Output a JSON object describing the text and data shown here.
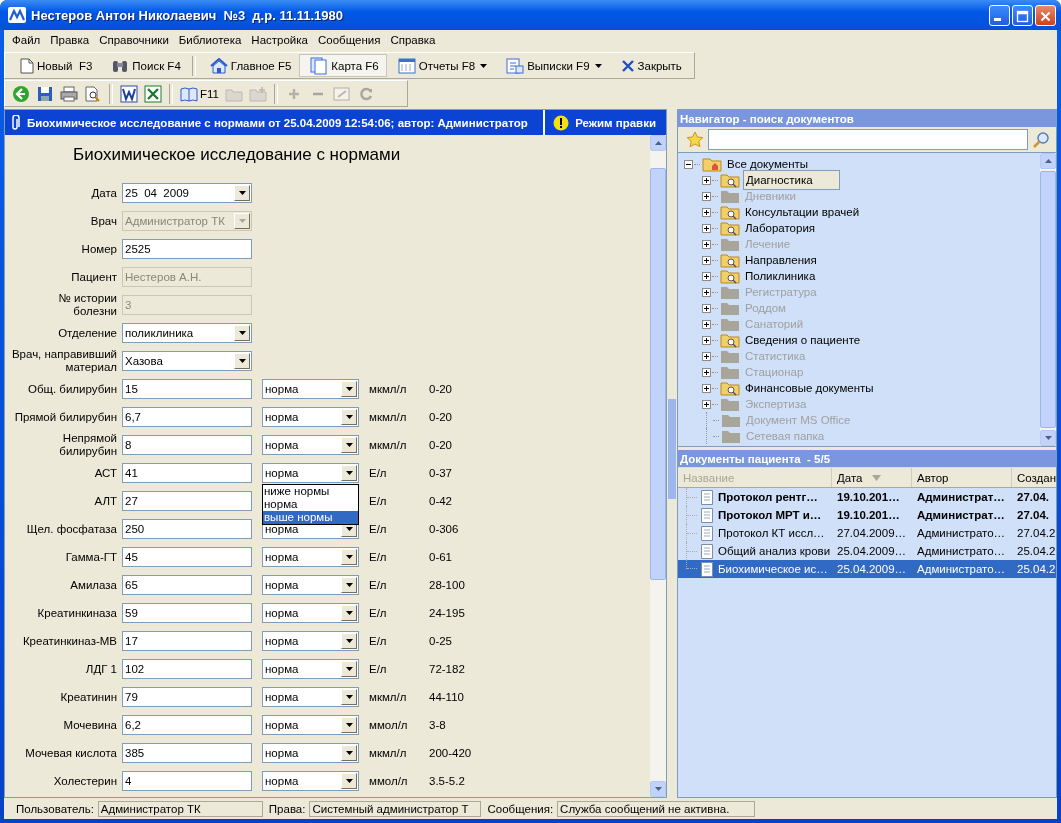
{
  "window": {
    "title": "Нестеров Антон Николаевич  №3  д.р. 11.11.1980"
  },
  "menu": [
    {
      "label": "Файл"
    },
    {
      "label": "Правка"
    },
    {
      "label": "Справочники"
    },
    {
      "label": "Библиотека"
    },
    {
      "label": "Настройка"
    },
    {
      "label": "Сообщения"
    },
    {
      "label": "Справка"
    }
  ],
  "toolbar": [
    {
      "kind": "button",
      "label": "Новый  F3",
      "selected": false,
      "dropdown": false
    },
    {
      "kind": "button",
      "label": "Поиск F4",
      "selected": false,
      "dropdown": false
    },
    {
      "kind": "separator"
    },
    {
      "kind": "button",
      "label": "Главное F5",
      "selected": false,
      "dropdown": false
    },
    {
      "kind": "button",
      "label": "Карта F6",
      "selected": true,
      "dropdown": false
    },
    {
      "kind": "button",
      "label": "Отчеты F8",
      "selected": false,
      "dropdown": true
    },
    {
      "kind": "button",
      "label": "Выписки F9",
      "selected": false,
      "dropdown": true
    },
    {
      "kind": "button",
      "label": "Закрыть",
      "selected": false,
      "dropdown": false
    }
  ],
  "toolbar2": [
    {
      "kind": "button",
      "disabled": false
    },
    {
      "kind": "button",
      "disabled": false
    },
    {
      "kind": "button",
      "disabled": false
    },
    {
      "kind": "button",
      "disabled": false
    },
    {
      "kind": "separator"
    },
    {
      "kind": "button",
      "disabled": false
    },
    {
      "kind": "button",
      "disabled": false
    },
    {
      "kind": "separator"
    },
    {
      "kind": "button",
      "label": "F11",
      "disabled": false
    },
    {
      "kind": "button",
      "disabled": true
    },
    {
      "kind": "button",
      "disabled": true
    },
    {
      "kind": "separator"
    },
    {
      "kind": "button",
      "disabled": true
    },
    {
      "kind": "button",
      "disabled": true
    },
    {
      "kind": "button",
      "disabled": true
    },
    {
      "kind": "button",
      "disabled": true
    }
  ],
  "document_header": {
    "title": "Биохимическое исследование с нормами от 25.04.2009 12:54:06; автор: Администратор",
    "mode": "Режим правки"
  },
  "form": {
    "title": "Биохимическое исследование с нормами",
    "fields": [
      {
        "label": "Дата",
        "value": "25  04  2009",
        "kind": "combo",
        "disabled": false
      },
      {
        "label": "Врач",
        "value": "Администратор ТК",
        "kind": "combo",
        "disabled": true
      },
      {
        "label": "Номер",
        "value": "2525",
        "kind": "text",
        "disabled": false
      },
      {
        "label": "Пациент",
        "value": "Нестеров А.Н.",
        "kind": "text",
        "disabled": true
      },
      {
        "label": "№ истории\nболезни",
        "value": "3",
        "kind": "text",
        "disabled": true
      },
      {
        "label": "Отделение",
        "value": "поликлиника",
        "kind": "combo",
        "disabled": false
      },
      {
        "label": "Врач, направивший\nматериал",
        "value": "Хазова",
        "kind": "combo",
        "disabled": false
      }
    ],
    "tests": [
      {
        "name": "Общ. билирубин",
        "value": "15",
        "status": "норма",
        "unit": "мкмл/л",
        "range": "0-20",
        "open": false
      },
      {
        "name": "Прямой билирубин",
        "value": "6,7",
        "status": "норма",
        "unit": "мкмл/л",
        "range": "0-20",
        "open": false
      },
      {
        "name": "Непрямой\nбилирубин",
        "value": "8",
        "status": "норма",
        "unit": "мкмл/л",
        "range": "0-20",
        "open": false
      },
      {
        "name": "АСТ",
        "value": "41",
        "status": "норма",
        "unit": "Е/л",
        "range": "0-37",
        "open": true,
        "options": [
          {
            "label": "ниже нормы",
            "selected": false
          },
          {
            "label": "норма",
            "selected": false
          },
          {
            "label": "выше нормы",
            "selected": true
          }
        ]
      },
      {
        "name": "АЛТ",
        "value": "27",
        "unit": "Е/л",
        "range": "0-42",
        "open": false
      },
      {
        "name": "Щел. фосфатаза",
        "value": "250",
        "status": "норма",
        "unit": "Е/л",
        "range": "0-306",
        "open": false
      },
      {
        "name": "Гамма-ГТ",
        "value": "45",
        "status": "норма",
        "unit": "Е/л",
        "range": "0-61",
        "open": false
      },
      {
        "name": "Амилаза",
        "value": "65",
        "status": "норма",
        "unit": "Е/л",
        "range": "28-100",
        "open": false
      },
      {
        "name": "Креатинкиназа",
        "value": "59",
        "status": "норма",
        "unit": "Е/л",
        "range": "24-195",
        "open": false
      },
      {
        "name": "Креатинкиназ-МВ",
        "value": "17",
        "status": "норма",
        "unit": "Е/л",
        "range": "0-25",
        "open": false
      },
      {
        "name": "ЛДГ 1",
        "value": "102",
        "status": "норма",
        "unit": "Е/л",
        "range": "72-182",
        "open": false
      },
      {
        "name": "Креатинин",
        "value": "79",
        "status": "норма",
        "unit": "мкмл/л",
        "range": "44-110",
        "open": false
      },
      {
        "name": "Мочевина",
        "value": "6,2",
        "status": "норма",
        "unit": "ммол/л",
        "range": "3-8",
        "open": false
      },
      {
        "name": "Мочевая кислота",
        "value": "385",
        "status": "норма",
        "unit": "мкмл/л",
        "range": "200-420",
        "open": false
      },
      {
        "name": "Холестерин",
        "value": "4",
        "status": "норма",
        "unit": "ммол/л",
        "range": "3.5-5.2",
        "open": false
      }
    ]
  },
  "navigator": {
    "title": "Навигатор - поиск документов",
    "tree": {
      "label": "Все документы",
      "expanded": true,
      "children": [
        {
          "label": "Диагностика",
          "disabled": false,
          "expandable": true,
          "selected": true
        },
        {
          "label": "Дневники",
          "disabled": true,
          "expandable": true,
          "selected": false
        },
        {
          "label": "Консультации врачей",
          "disabled": false,
          "expandable": true,
          "selected": false
        },
        {
          "label": "Лаборатория",
          "disabled": false,
          "expandable": true,
          "selected": false
        },
        {
          "label": "Лечение",
          "disabled": true,
          "expandable": true,
          "selected": false
        },
        {
          "label": "Направления",
          "disabled": false,
          "expandable": true,
          "selected": false
        },
        {
          "label": "Поликлиника",
          "disabled": false,
          "expandable": true,
          "selected": false
        },
        {
          "label": "Регистратура",
          "disabled": true,
          "expandable": true,
          "selected": false
        },
        {
          "label": "Роддом",
          "disabled": true,
          "expandable": true,
          "selected": false
        },
        {
          "label": "Санаторий",
          "disabled": true,
          "expandable": true,
          "selected": false
        },
        {
          "label": "Сведения о пациенте",
          "disabled": false,
          "expandable": true,
          "selected": false
        },
        {
          "label": "Статистика",
          "disabled": true,
          "expandable": true,
          "selected": false
        },
        {
          "label": "Стационар",
          "disabled": true,
          "expandable": true,
          "selected": false
        },
        {
          "label": "Финансовые документы",
          "disabled": false,
          "expandable": true,
          "selected": false
        },
        {
          "label": "Экспертиза",
          "disabled": true,
          "expandable": true,
          "selected": false
        },
        {
          "label": "Документ MS Office",
          "disabled": true,
          "expandable": false,
          "selected": false
        },
        {
          "label": "Сетевая папка",
          "disabled": true,
          "expandable": false,
          "selected": false
        }
      ]
    }
  },
  "patient_documents": {
    "title": "Документы пациента  - 5/5",
    "columns": [
      {
        "label": "Название",
        "sorted": false,
        "disabled": true
      },
      {
        "label": "Дата",
        "sorted": true,
        "disabled": false
      },
      {
        "label": "Автор",
        "sorted": false,
        "disabled": false
      },
      {
        "label": "Создан",
        "sorted": false,
        "disabled": false
      }
    ],
    "rows": [
      {
        "cells": [
          "Протокол рентг…",
          "19.10.201…",
          "Администрат…",
          "27.04."
        ],
        "bold": true,
        "selected": false
      },
      {
        "cells": [
          "Протокол МРТ и…",
          "19.10.201…",
          "Администрат…",
          "27.04."
        ],
        "bold": true,
        "selected": false
      },
      {
        "cells": [
          "Протокол КТ иссл…",
          "27.04.2009…",
          "Администрато…",
          "27.04.2"
        ],
        "bold": false,
        "selected": false
      },
      {
        "cells": [
          "Общий анализ крови",
          "25.04.2009…",
          "Администрато…",
          "25.04.2"
        ],
        "bold": false,
        "selected": false
      },
      {
        "cells": [
          "Биохимическое ис…",
          "25.04.2009…",
          "Администрато…",
          "25.04.2"
        ],
        "bold": false,
        "selected": true
      }
    ]
  },
  "status_bar": [
    {
      "label": "Пользователь:",
      "value": "Администратор ТК"
    },
    {
      "label": "Права:",
      "value": "Системный администратор Т"
    },
    {
      "label": "Сообщения:",
      "value": "Служба сообщений не активна."
    }
  ]
}
